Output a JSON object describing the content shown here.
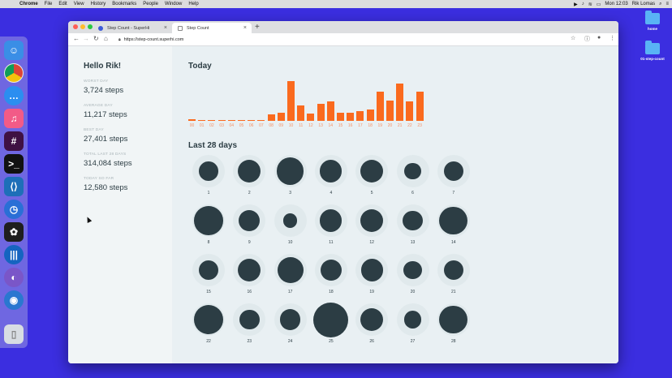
{
  "menubar": {
    "app_name": "Chrome",
    "menus": [
      "File",
      "Edit",
      "View",
      "History",
      "Bookmarks",
      "People",
      "Window",
      "Help"
    ],
    "clock": "Mon 12:03",
    "user": "Rik Lomas"
  },
  "desktop": {
    "icons": [
      {
        "label": "home"
      },
      {
        "label": "01-step-count"
      }
    ]
  },
  "browser": {
    "tabs": [
      {
        "title": "Step Count - SuperHi",
        "active": false
      },
      {
        "title": "Step Count",
        "active": true
      }
    ],
    "url": "https://step-count.superhi.com"
  },
  "sidebar": {
    "greeting": "Hello Rik!",
    "stats": [
      {
        "label": "WORST DAY",
        "value": "3,724 steps"
      },
      {
        "label": "AVERAGE DAY",
        "value": "11,217 steps"
      },
      {
        "label": "BEST DAY",
        "value": "27,401 steps"
      },
      {
        "label": "TOTAL LAST 28 DAYS",
        "value": "314,084 steps"
      },
      {
        "label": "TODAY SO FAR",
        "value": "12,580 steps"
      }
    ]
  },
  "today": {
    "title": "Today",
    "hours": [
      "00",
      "01",
      "02",
      "03",
      "04",
      "05",
      "06",
      "07",
      "08",
      "09",
      "10",
      "11",
      "12",
      "13",
      "14",
      "15",
      "16",
      "17",
      "18",
      "19",
      "20",
      "21",
      "22",
      "23"
    ],
    "values": [
      2,
      0.4,
      0.4,
      0.4,
      0.4,
      0.4,
      0.4,
      0.4,
      8,
      10,
      50,
      19,
      9,
      21,
      24,
      10,
      10,
      12,
      14,
      37,
      26,
      47,
      25,
      37
    ],
    "color": "#fa6a1e"
  },
  "last28": {
    "title": "Last 28 days",
    "days": [
      "1",
      "2",
      "3",
      "4",
      "5",
      "6",
      "7",
      "8",
      "9",
      "10",
      "11",
      "12",
      "13",
      "14",
      "15",
      "16",
      "17",
      "18",
      "19",
      "20",
      "21",
      "22",
      "23",
      "24",
      "25",
      "26",
      "27",
      "28"
    ],
    "sizes": [
      0.55,
      0.65,
      0.78,
      0.63,
      0.66,
      0.47,
      0.56,
      0.83,
      0.61,
      0.4,
      0.63,
      0.66,
      0.58,
      0.81,
      0.56,
      0.65,
      0.74,
      0.61,
      0.63,
      0.52,
      0.57,
      0.86,
      0.58,
      0.59,
      1.0,
      0.65,
      0.51,
      0.81
    ],
    "color": "#2c3d44"
  }
}
